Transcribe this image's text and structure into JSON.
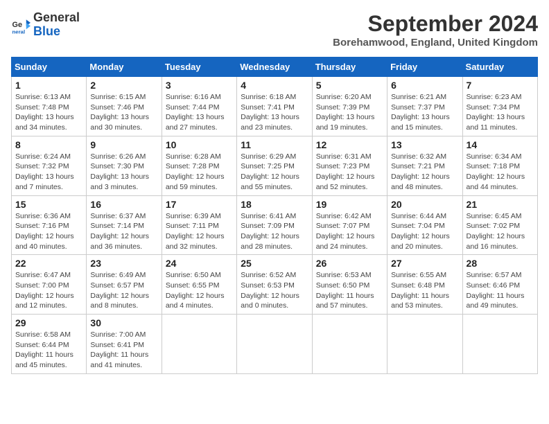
{
  "logo": {
    "general": "General",
    "blue": "Blue"
  },
  "title": "September 2024",
  "location": "Borehamwood, England, United Kingdom",
  "headers": [
    "Sunday",
    "Monday",
    "Tuesday",
    "Wednesday",
    "Thursday",
    "Friday",
    "Saturday"
  ],
  "weeks": [
    [
      {
        "day": "1",
        "info": "Sunrise: 6:13 AM\nSunset: 7:48 PM\nDaylight: 13 hours\nand 34 minutes."
      },
      {
        "day": "2",
        "info": "Sunrise: 6:15 AM\nSunset: 7:46 PM\nDaylight: 13 hours\nand 30 minutes."
      },
      {
        "day": "3",
        "info": "Sunrise: 6:16 AM\nSunset: 7:44 PM\nDaylight: 13 hours\nand 27 minutes."
      },
      {
        "day": "4",
        "info": "Sunrise: 6:18 AM\nSunset: 7:41 PM\nDaylight: 13 hours\nand 23 minutes."
      },
      {
        "day": "5",
        "info": "Sunrise: 6:20 AM\nSunset: 7:39 PM\nDaylight: 13 hours\nand 19 minutes."
      },
      {
        "day": "6",
        "info": "Sunrise: 6:21 AM\nSunset: 7:37 PM\nDaylight: 13 hours\nand 15 minutes."
      },
      {
        "day": "7",
        "info": "Sunrise: 6:23 AM\nSunset: 7:34 PM\nDaylight: 13 hours\nand 11 minutes."
      }
    ],
    [
      {
        "day": "8",
        "info": "Sunrise: 6:24 AM\nSunset: 7:32 PM\nDaylight: 13 hours\nand 7 minutes."
      },
      {
        "day": "9",
        "info": "Sunrise: 6:26 AM\nSunset: 7:30 PM\nDaylight: 13 hours\nand 3 minutes."
      },
      {
        "day": "10",
        "info": "Sunrise: 6:28 AM\nSunset: 7:28 PM\nDaylight: 12 hours\nand 59 minutes."
      },
      {
        "day": "11",
        "info": "Sunrise: 6:29 AM\nSunset: 7:25 PM\nDaylight: 12 hours\nand 55 minutes."
      },
      {
        "day": "12",
        "info": "Sunrise: 6:31 AM\nSunset: 7:23 PM\nDaylight: 12 hours\nand 52 minutes."
      },
      {
        "day": "13",
        "info": "Sunrise: 6:32 AM\nSunset: 7:21 PM\nDaylight: 12 hours\nand 48 minutes."
      },
      {
        "day": "14",
        "info": "Sunrise: 6:34 AM\nSunset: 7:18 PM\nDaylight: 12 hours\nand 44 minutes."
      }
    ],
    [
      {
        "day": "15",
        "info": "Sunrise: 6:36 AM\nSunset: 7:16 PM\nDaylight: 12 hours\nand 40 minutes."
      },
      {
        "day": "16",
        "info": "Sunrise: 6:37 AM\nSunset: 7:14 PM\nDaylight: 12 hours\nand 36 minutes."
      },
      {
        "day": "17",
        "info": "Sunrise: 6:39 AM\nSunset: 7:11 PM\nDaylight: 12 hours\nand 32 minutes."
      },
      {
        "day": "18",
        "info": "Sunrise: 6:41 AM\nSunset: 7:09 PM\nDaylight: 12 hours\nand 28 minutes."
      },
      {
        "day": "19",
        "info": "Sunrise: 6:42 AM\nSunset: 7:07 PM\nDaylight: 12 hours\nand 24 minutes."
      },
      {
        "day": "20",
        "info": "Sunrise: 6:44 AM\nSunset: 7:04 PM\nDaylight: 12 hours\nand 20 minutes."
      },
      {
        "day": "21",
        "info": "Sunrise: 6:45 AM\nSunset: 7:02 PM\nDaylight: 12 hours\nand 16 minutes."
      }
    ],
    [
      {
        "day": "22",
        "info": "Sunrise: 6:47 AM\nSunset: 7:00 PM\nDaylight: 12 hours\nand 12 minutes."
      },
      {
        "day": "23",
        "info": "Sunrise: 6:49 AM\nSunset: 6:57 PM\nDaylight: 12 hours\nand 8 minutes."
      },
      {
        "day": "24",
        "info": "Sunrise: 6:50 AM\nSunset: 6:55 PM\nDaylight: 12 hours\nand 4 minutes."
      },
      {
        "day": "25",
        "info": "Sunrise: 6:52 AM\nSunset: 6:53 PM\nDaylight: 12 hours\nand 0 minutes."
      },
      {
        "day": "26",
        "info": "Sunrise: 6:53 AM\nSunset: 6:50 PM\nDaylight: 11 hours\nand 57 minutes."
      },
      {
        "day": "27",
        "info": "Sunrise: 6:55 AM\nSunset: 6:48 PM\nDaylight: 11 hours\nand 53 minutes."
      },
      {
        "day": "28",
        "info": "Sunrise: 6:57 AM\nSunset: 6:46 PM\nDaylight: 11 hours\nand 49 minutes."
      }
    ],
    [
      {
        "day": "29",
        "info": "Sunrise: 6:58 AM\nSunset: 6:44 PM\nDaylight: 11 hours\nand 45 minutes."
      },
      {
        "day": "30",
        "info": "Sunrise: 7:00 AM\nSunset: 6:41 PM\nDaylight: 11 hours\nand 41 minutes."
      },
      {
        "day": "",
        "info": ""
      },
      {
        "day": "",
        "info": ""
      },
      {
        "day": "",
        "info": ""
      },
      {
        "day": "",
        "info": ""
      },
      {
        "day": "",
        "info": ""
      }
    ]
  ]
}
